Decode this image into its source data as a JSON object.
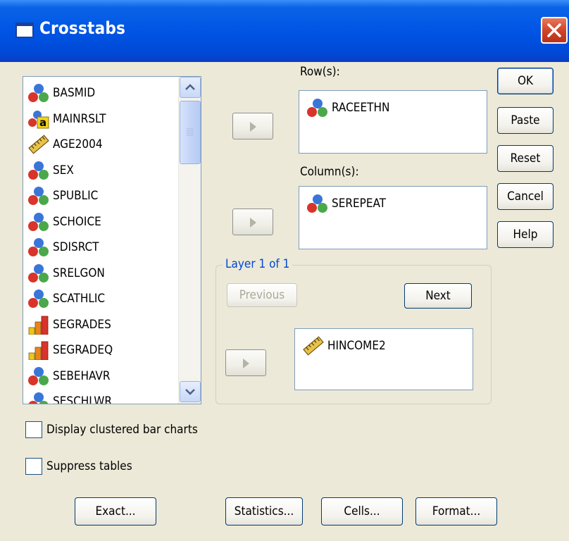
{
  "window": {
    "title": "Crosstabs"
  },
  "variables": [
    {
      "name": "BASMID",
      "icon": "nominal-icon"
    },
    {
      "name": "MAINRSLT",
      "icon": "nominal-string-icon"
    },
    {
      "name": "AGE2004",
      "icon": "scale-icon"
    },
    {
      "name": "SEX",
      "icon": "nominal-icon"
    },
    {
      "name": "SPUBLIC",
      "icon": "nominal-icon"
    },
    {
      "name": "SCHOICE",
      "icon": "nominal-icon"
    },
    {
      "name": "SDISRCT",
      "icon": "nominal-icon"
    },
    {
      "name": "SRELGON",
      "icon": "nominal-icon"
    },
    {
      "name": "SCATHLIC",
      "icon": "nominal-icon"
    },
    {
      "name": "SEGRADES",
      "icon": "ordinal-icon"
    },
    {
      "name": "SEGRADEQ",
      "icon": "ordinal-icon"
    },
    {
      "name": "SEBEHAVR",
      "icon": "nominal-icon"
    },
    {
      "name": "SESCHLWR",
      "icon": "nominal-icon"
    }
  ],
  "rows": {
    "label": "Row(s):",
    "variable": "RACEETHN"
  },
  "columns": {
    "label": "Column(s):",
    "variable": "SEREPEAT"
  },
  "layer": {
    "title": "Layer 1 of 1",
    "previous_label": "Previous",
    "next_label": "Next",
    "variable": "HINCOME2"
  },
  "buttons": {
    "ok": "OK",
    "paste": "Paste",
    "reset": "Reset",
    "cancel": "Cancel",
    "help": "Help"
  },
  "checkboxes": {
    "clustered_bar": "Display clustered bar charts",
    "suppress_tables": "Suppress tables"
  },
  "bottom_buttons": {
    "exact": "Exact...",
    "statistics": "Statistics...",
    "cells": "Cells...",
    "format": "Format..."
  },
  "colors": {
    "titlebar": "#0055e5",
    "close": "#d2432a",
    "group_title": "#0046d5",
    "window_bg": "#ece9d8"
  }
}
